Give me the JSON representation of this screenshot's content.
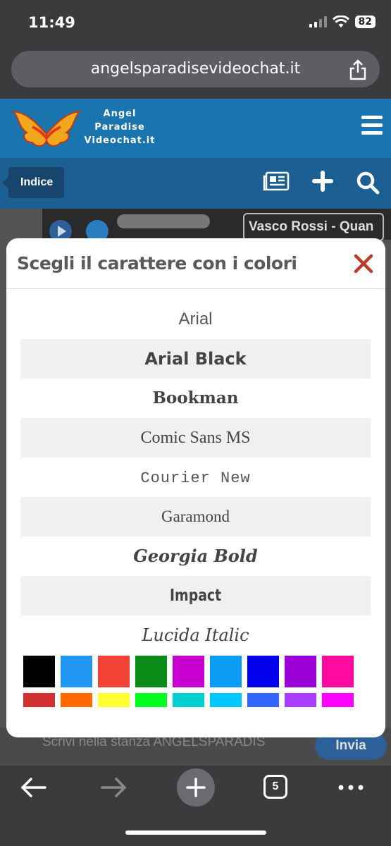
{
  "status_bar": {
    "time": "11:49",
    "battery": "82"
  },
  "browser": {
    "url": "angelsparadisevideochat.it",
    "open_tabs": "5"
  },
  "site": {
    "logo_lines": [
      "Angel",
      "Paradise",
      "Videochat.it"
    ],
    "nav_label": "Indice"
  },
  "background": {
    "song_title": "Vasco Rossi - Quan",
    "chat_placeholder": "Scrivi nella stanza ANGELSPARADIS",
    "send_label": "Invia"
  },
  "modal": {
    "title": "Scegli il carattere con i colori",
    "fonts": [
      "Arial",
      "Arial Black",
      "Bookman",
      "Comic Sans MS",
      "Courier New",
      "Garamond",
      "Georgia Bold",
      "Impact",
      "Lucida Italic"
    ],
    "colors_row1": [
      "#000000",
      "#2196f3",
      "#f44336",
      "#0a8a17",
      "#c800d0",
      "#0b9cf5",
      "#0000ee",
      "#9b00d8",
      "#ff0aa0"
    ],
    "colors_row2": [
      "#d03030",
      "#ff6a00",
      "#ffff33",
      "#00ff20",
      "#00cfcf",
      "#00c8ff",
      "#3366ff",
      "#a83dff",
      "#ff00ff"
    ]
  }
}
